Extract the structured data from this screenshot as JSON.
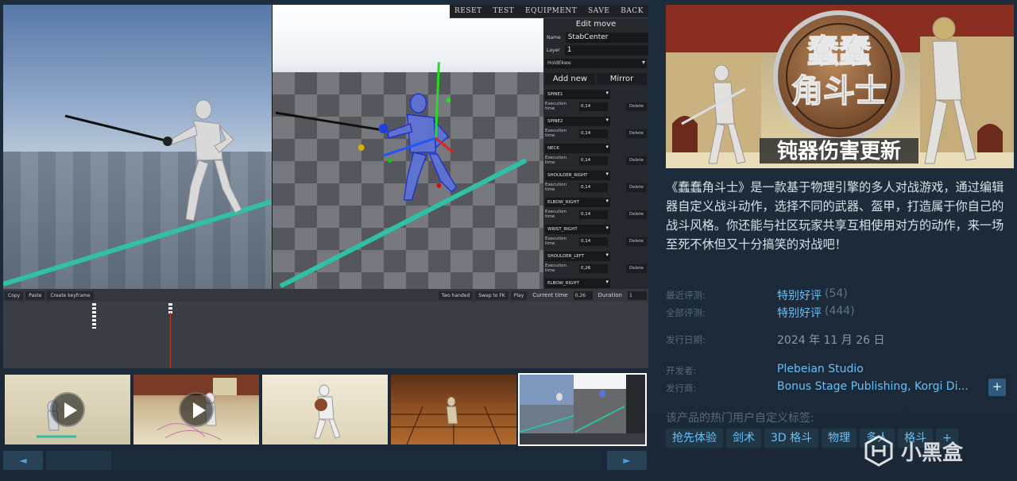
{
  "editor": {
    "menu": [
      "RESET",
      "TEST",
      "EQUIPMENT",
      "SAVE",
      "BACK"
    ],
    "panel_title": "Edit move",
    "name_label": "Name",
    "name_value": "StabCenter",
    "layer_label": "Layer",
    "layer_value": "1",
    "hold_item": "HoldEkwe",
    "add_new": "Add new",
    "mirror": "Mirror",
    "exec_label": "Execution time",
    "delete_label": "Delete",
    "bones": [
      {
        "name": "SPINE1",
        "time": "0,14"
      },
      {
        "name": "SPINE2",
        "time": "0,14"
      },
      {
        "name": "NECK",
        "time": "0,14"
      },
      {
        "name": "SHOULDER_RIGHT",
        "time": "0,14"
      },
      {
        "name": "ELBOW_RIGHT",
        "time": "0,14"
      },
      {
        "name": "WRIST_RIGHT",
        "time": "0,14"
      },
      {
        "name": "SHOULDER_LEFT",
        "time": "0,26"
      },
      {
        "name": "ELBOW_RIGHT",
        "time": "0,14"
      }
    ],
    "timeline": {
      "copy": "Copy",
      "paste": "Paste",
      "create_keyframe": "Create keyframe",
      "two_handed": "Two handed",
      "swap_fk": "Swap to FK",
      "play": "Play",
      "current_time_label": "Current time",
      "current_time": "0,26",
      "duration_label": "Duration",
      "duration": "1"
    }
  },
  "capsule": {
    "logo_line1": "蠢蠢",
    "logo_line2": "角斗士",
    "banner": "钝器伤害更新"
  },
  "description": "《蠢蠢角斗士》是一款基于物理引擎的多人对战游戏，通过编辑器自定义战斗动作，选择不同的武器、盔甲，打造属于你自己的战斗风格。你还能与社区玩家共享互相使用对方的动作，来一场至死不休但又十分搞笑的对战吧！",
  "reviews": {
    "recent_label": "最近评测:",
    "recent_value": "特别好评",
    "recent_count": "(54)",
    "all_label": "全部评测:",
    "all_value": "特别好评",
    "all_count": "(444)"
  },
  "release": {
    "label": "发行日期:",
    "value": "2024 年 11 月 26 日"
  },
  "developer": {
    "label": "开发者:",
    "value": "Plebeian Studio"
  },
  "publisher": {
    "label": "发行商:",
    "value": "Bonus Stage Publishing, Korgi Di..."
  },
  "plus": "+",
  "tags_title": "该产品的热门用户自定义标签:",
  "tags": [
    "抢先体验",
    "剑术",
    "3D 格斗",
    "物理",
    "多人",
    "格斗",
    "+"
  ],
  "slider": {
    "left": "◄",
    "right": "►"
  },
  "watermark": "小黑盒"
}
